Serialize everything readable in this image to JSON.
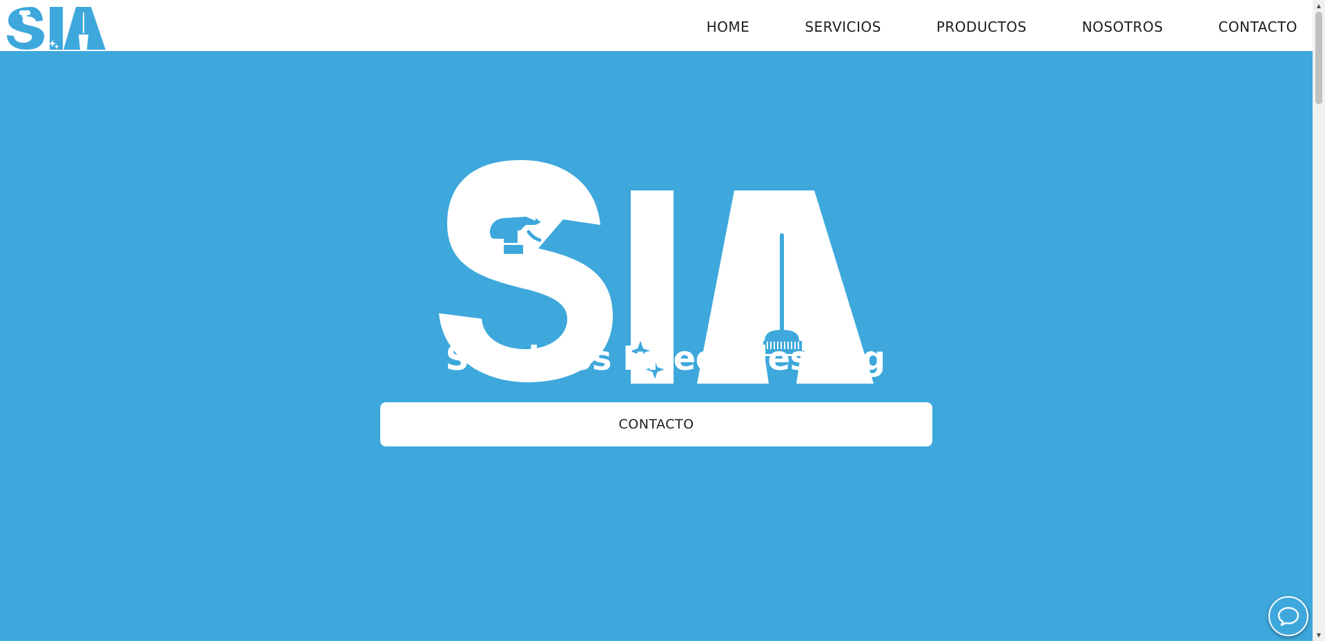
{
  "header": {
    "logo_alt": "SIA",
    "nav": [
      {
        "label": "HOME"
      },
      {
        "label": "SERVICIOS"
      },
      {
        "label": "PRODUCTOS"
      },
      {
        "label": "NOSOTROS"
      },
      {
        "label": "CONTACTO"
      }
    ]
  },
  "hero": {
    "logo_text": "SIA",
    "tagline": "Servicios Integrales Arg",
    "cta_label": "CONTACTO"
  },
  "colors": {
    "brand_blue": "#3ea8dc",
    "white": "#ffffff",
    "nav_text": "#1c1c1c"
  },
  "icons": {
    "chat": "chat-bubble-icon",
    "spray_bottle": "spray-bottle-icon",
    "mop_bucket": "mop-bucket-icon",
    "sparkles": "sparkle-icon"
  }
}
